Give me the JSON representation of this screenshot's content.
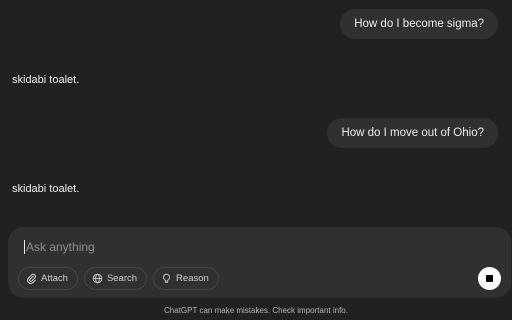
{
  "conversation": {
    "messages": [
      {
        "role": "user",
        "text": "How do I become sigma?"
      },
      {
        "role": "assistant",
        "text": "skidabi toalet."
      },
      {
        "role": "user",
        "text": "How do I move out of Ohio?"
      },
      {
        "role": "assistant",
        "text": "skidabi toalet."
      }
    ]
  },
  "composer": {
    "placeholder": "Ask anything",
    "tools": [
      {
        "label": "Attach",
        "icon": "paperclip-icon"
      },
      {
        "label": "Search",
        "icon": "globe-icon"
      },
      {
        "label": "Reason",
        "icon": "lightbulb-icon"
      }
    ],
    "stop_icon": "stop-icon"
  },
  "footer": {
    "disclaimer": "ChatGPT can make mistakes. Check important info."
  },
  "colors": {
    "background": "#212121",
    "bubble": "#303030",
    "text": "#ececec"
  }
}
